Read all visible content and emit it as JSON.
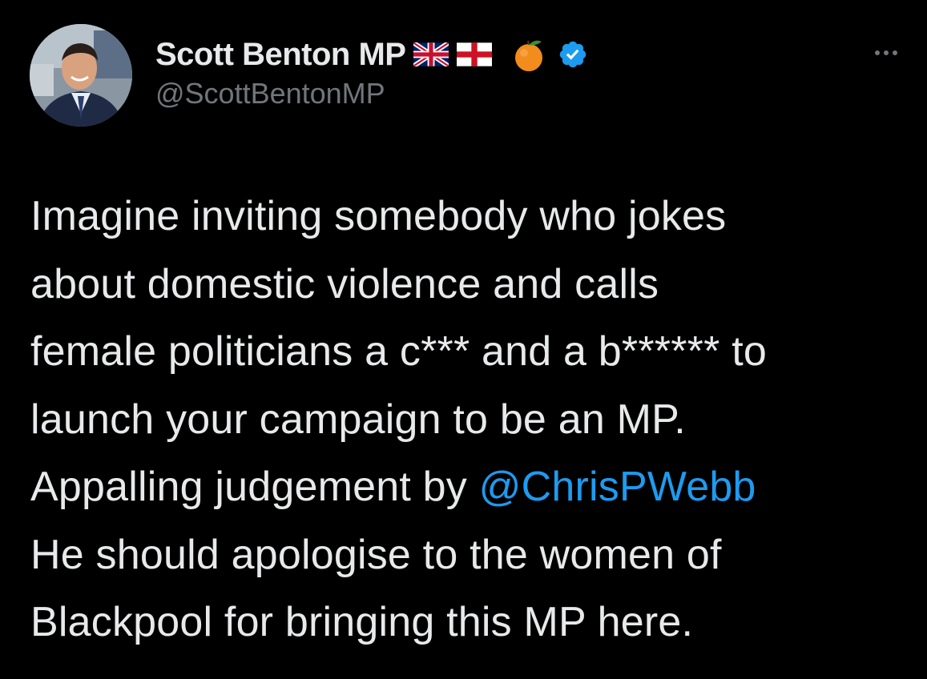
{
  "author": {
    "display_name": "Scott Benton MP",
    "handle": "@ScottBentonMP",
    "name_badges": [
      "uk-flag-icon",
      "england-flag-icon",
      "tangerine-icon",
      "verified-badge-icon"
    ]
  },
  "tweet": {
    "lines": [
      "Imagine inviting somebody who jokes",
      "about domestic violence and calls",
      "female politicians a c*** and a b****** to",
      "launch your campaign to be an MP."
    ],
    "line5_prefix": "Appalling judgement by ",
    "mention": "@ChrisPWebb",
    "lines_after": [
      "He should apologise to the women of",
      "Blackpool for bringing this MP here."
    ]
  },
  "colors": {
    "background": "#000000",
    "text": "#e7e9ea",
    "secondary": "#71767b",
    "link": "#1d9bf0",
    "verified": "#1d9bf0"
  },
  "icons": {
    "more": "more-options-icon"
  }
}
